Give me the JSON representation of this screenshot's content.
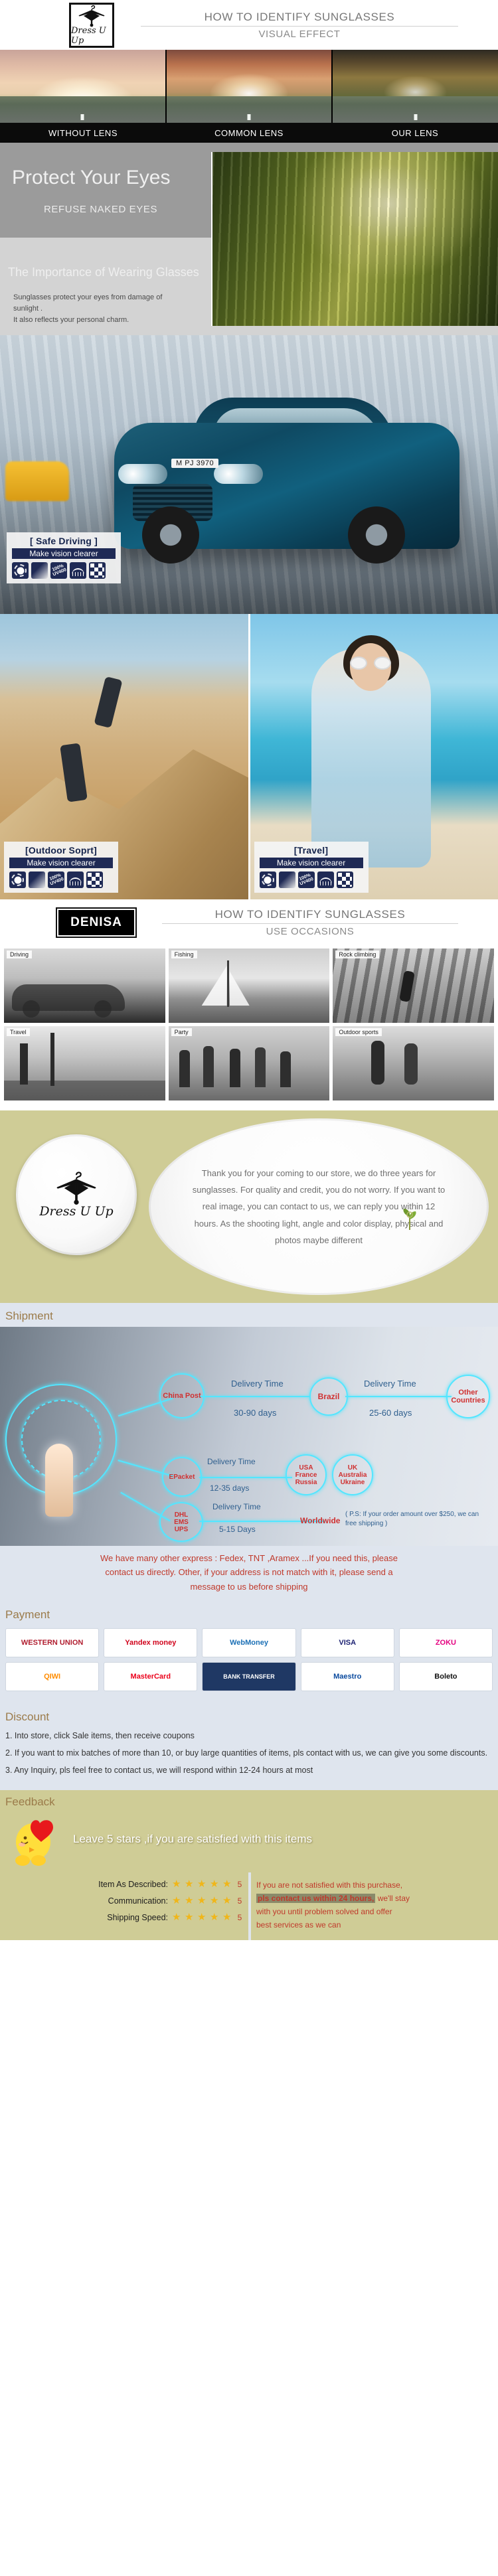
{
  "brand": {
    "logo_icon": "clothes-hanger-icon",
    "name": "Dress U Up",
    "badge_name": "DENISA"
  },
  "header": {
    "line1": "HOW TO IDENTIFY SUNGLASSES",
    "line2": "VISUAL EFFECT"
  },
  "visual_effect": {
    "panels": [
      {
        "label": "WITHOUT LENS"
      },
      {
        "label": "COMMON LENS"
      },
      {
        "label": "OUR LENS"
      }
    ]
  },
  "protect": {
    "title": "Protect Your Eyes",
    "subtitle": "REFUSE NAKED EYES",
    "section_title": "The Importance of Wearing Glasses",
    "para1": "Sunglasses protect your eyes from damage of",
    "para1b": "sunlight .",
    "para2": "It also reflects your personal charm."
  },
  "badges": [
    {
      "title": "[ Safe Driving ]",
      "subtitle": "Make vision clearer",
      "icons": [
        "sun-glare-icon",
        "gradient-lens-icon",
        "uv400-icon",
        "eye-lash-icon",
        "checker-polarized-icon"
      ]
    },
    {
      "title": "[Outdoor Soprt]",
      "subtitle": "Make vision clearer",
      "icons": [
        "sun-glare-icon",
        "gradient-lens-icon",
        "uv400-icon",
        "eye-lash-icon",
        "checker-polarized-icon"
      ]
    },
    {
      "title": "[Travel]",
      "subtitle": "Make vision clearer",
      "icons": [
        "sun-glare-icon",
        "gradient-lens-icon",
        "uv400-icon",
        "eye-lash-icon",
        "checker-polarized-icon"
      ]
    }
  ],
  "car": {
    "plate": "M PJ 3970"
  },
  "occasions": {
    "header_line1": "HOW TO IDENTIFY SUNGLASSES",
    "header_line2": "USE OCCASIONS",
    "cells": [
      {
        "label": "Driving"
      },
      {
        "label": "Fishing"
      },
      {
        "label": "Rock climbing"
      },
      {
        "label": "Travel"
      },
      {
        "label": "Party"
      },
      {
        "label": "Outdoor sports"
      }
    ]
  },
  "thanks": {
    "text": "Thank you for your coming to our store, we do three years for sunglasses. For quality and credit, you do not worry. If you want to real image, you can contact to us, we can reply you within 12 hours. As the shooting light, angle and color display, physical and photos maybe different"
  },
  "shipment": {
    "title": "Shipment",
    "carriers": [
      {
        "name": "China Post"
      },
      {
        "name": "EPacket"
      },
      {
        "name": "DHL\nEMS\nUPS"
      }
    ],
    "routes": [
      {
        "delivery_label": "Delivery Time",
        "time": "30-90 days",
        "destination": "Brazil"
      },
      {
        "delivery_label": "Delivery Time",
        "time": "25-60 days",
        "destination": "Other Countries"
      },
      {
        "delivery_label": "Delivery Time",
        "time": "12-35 days",
        "destination": "USA\nFrance\nRussia"
      },
      {
        "delivery_label": "",
        "time": "",
        "destination": "UK\nAustralia\nUkraine"
      },
      {
        "delivery_label": "Delivery Time",
        "time": "5-15 Days",
        "destination": "Worldwide"
      }
    ],
    "ps_note": "( P.S: If your order amount over $250, we can free shipping )",
    "note1": "We have many other express : Fedex, TNT ,Aramex ...If you need this, please",
    "note2": "contact us directly. Other, if your address is not match with it, please send a",
    "note3": "message to us before shipping"
  },
  "payment": {
    "title": "Payment",
    "methods": [
      {
        "name": "WESTERN UNION",
        "icon": "western-union-logo"
      },
      {
        "name": "Yandex money",
        "icon": "yandex-money-logo"
      },
      {
        "name": "WebMoney",
        "icon": "webmoney-logo"
      },
      {
        "name": "VISA",
        "icon": "visa-logo"
      },
      {
        "name": "ZOKU",
        "icon": "zoku-logo"
      },
      {
        "name": "QIWI",
        "icon": "qiwi-logo"
      },
      {
        "name": "MasterCard",
        "icon": "mastercard-logo"
      },
      {
        "name": "BANK TRANSFER",
        "icon": "bank-transfer-logo"
      },
      {
        "name": "Maestro",
        "icon": "maestro-logo"
      },
      {
        "name": "Boleto",
        "icon": "boleto-logo"
      }
    ]
  },
  "discount": {
    "title": "Discount",
    "items": [
      "1. Into store, click Sale items, then receive coupons",
      "2. If you want to mix batches of more than 10, or buy large quantities of items, pls contact with us, we can give you some discounts.",
      "3. Any Inquiry, pls feel free to contact us, we will respond within 12-24 hours at most"
    ]
  },
  "feedback": {
    "title": "Feedback",
    "icon": "chick-with-heart-icon",
    "message": "Leave 5 stars ,if you are satisfied with this items",
    "ratings": [
      {
        "label": "Item As Described:",
        "stars": 5,
        "value": "5"
      },
      {
        "label": "Communication:",
        "stars": 5,
        "value": "5"
      },
      {
        "label": "Shipping Speed:",
        "stars": 5,
        "value": "5"
      }
    ],
    "warning": {
      "line1": "If you are not satisfied with this purchase,",
      "highlight": "pls contact us within 24 hours,",
      "line2": " we'll stay",
      "line3": "with you until problem solved and offer",
      "line4": "best services as we can"
    }
  },
  "colors": {
    "olive": "#cfcc96",
    "panel_blue": "#dfe5ee",
    "accent_red": "#c0392b",
    "title_brown": "#9b7b4a",
    "cyan": "#53e6ff",
    "navy": "#1f2a55"
  }
}
